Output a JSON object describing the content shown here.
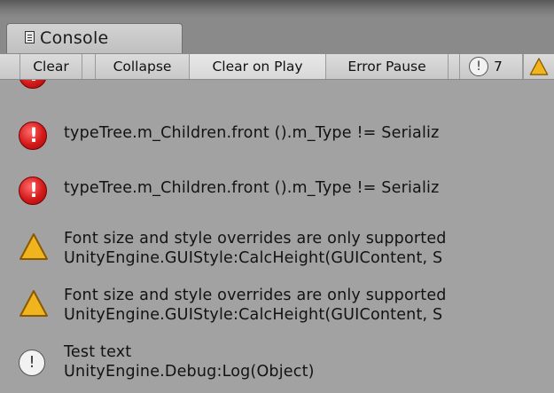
{
  "window": {
    "tab_title": "Console",
    "tab_icon": "console-document-icon"
  },
  "toolbar": {
    "clear_label": "Clear",
    "collapse_label": "Collapse",
    "clear_on_play_label": "Clear on Play",
    "error_pause_label": "Error Pause",
    "log_count": "7",
    "log_count_icon": "info-icon",
    "warning_count_icon": "warning-icon"
  },
  "log_entries": [
    {
      "type": "error",
      "icon": "error-icon",
      "line1": "typeTree.m_Children.front ().m_Type != Serializ",
      "line2": ""
    },
    {
      "type": "error",
      "icon": "error-icon",
      "line1": "typeTree.m_Children.front ().m_Type != Serializ",
      "line2": ""
    },
    {
      "type": "warning",
      "icon": "warning-icon",
      "line1": "Font size and style overrides are only supported",
      "line2": "UnityEngine.GUIStyle:CalcHeight(GUIContent, S"
    },
    {
      "type": "warning",
      "icon": "warning-icon",
      "line1": "Font size and style overrides are only supported",
      "line2": "UnityEngine.GUIStyle:CalcHeight(GUIContent, S"
    },
    {
      "type": "log",
      "icon": "info-icon",
      "line1": "Test text",
      "line2": "UnityEngine.Debug:Log(Object)"
    }
  ],
  "colors": {
    "error": "#d41a1a",
    "warning": "#f0b41e",
    "panel_background": "#a2a2a2"
  }
}
